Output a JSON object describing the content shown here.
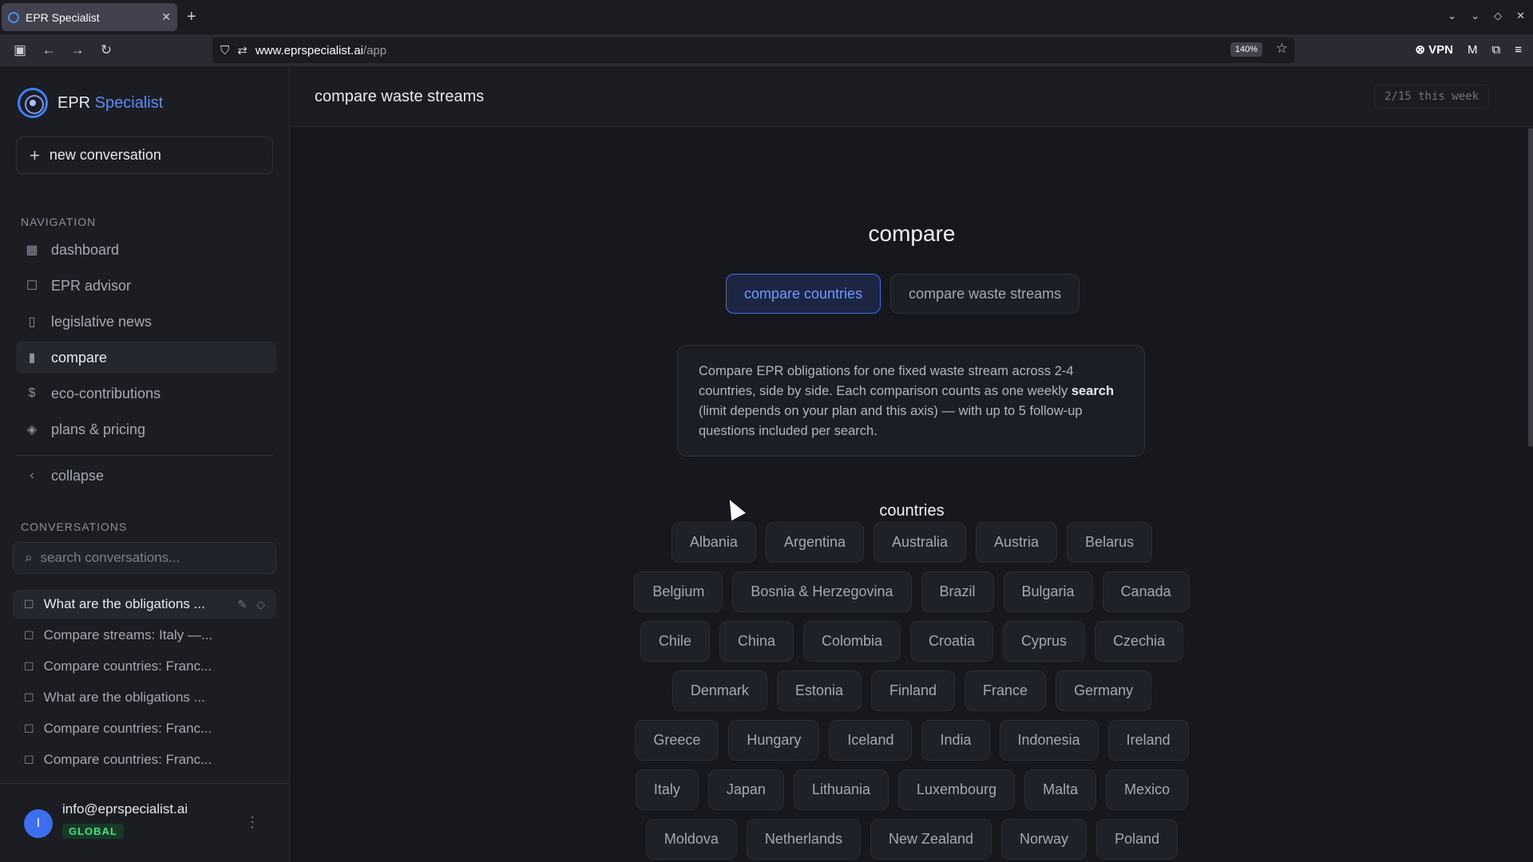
{
  "browser": {
    "tab_title": "EPR Specialist",
    "url_host": "www.eprspecialist.ai",
    "url_path": "/app",
    "zoom": "140%",
    "vpn_label": "VPN",
    "account_initial": "M"
  },
  "sidebar": {
    "brand_part1": "EPR",
    "brand_part2": "Specialist",
    "new_conversation": "new conversation",
    "navigation_label": "NAVIGATION",
    "nav_items": [
      {
        "label": "dashboard",
        "icon": "grid-icon"
      },
      {
        "label": "EPR advisor",
        "icon": "chat-icon"
      },
      {
        "label": "legislative news",
        "icon": "document-icon"
      },
      {
        "label": "compare",
        "icon": "bar-chart-icon"
      },
      {
        "label": "eco-contributions",
        "icon": "dollar-icon"
      },
      {
        "label": "plans & pricing",
        "icon": "layers-icon"
      }
    ],
    "collapse": "collapse",
    "conversations_label": "CONVERSATIONS",
    "search_placeholder": "search conversations...",
    "conversations": [
      "What are the obligations ...",
      "Compare streams: Italy —...",
      "Compare countries: Franc...",
      "What are the obligations ...",
      "Compare countries: Franc...",
      "Compare countries: Franc..."
    ],
    "user_email": "info@eprspecialist.ai",
    "user_initial": "I",
    "plan": "GLOBAL"
  },
  "header": {
    "title": "compare waste streams",
    "usage": "2/15 this week"
  },
  "main": {
    "title": "compare",
    "tabs": [
      "compare countries",
      "compare waste streams"
    ],
    "info_part1": "Compare EPR obligations for one fixed waste stream across 2-4 countries, side by side. Each comparison counts as one weekly ",
    "info_bold": "search",
    "info_part2": " (limit depends on your plan and this axis) — with up to 5 follow-up questions included per search.",
    "countries_label": "countries",
    "country_rows": [
      [
        "Albania",
        "Argentina",
        "Australia",
        "Austria",
        "Belarus"
      ],
      [
        "Belgium",
        "Bosnia & Herzegovina",
        "Brazil",
        "Bulgaria",
        "Canada"
      ],
      [
        "Chile",
        "China",
        "Colombia",
        "Croatia",
        "Cyprus",
        "Czechia"
      ],
      [
        "Denmark",
        "Estonia",
        "Finland",
        "France",
        "Germany"
      ],
      [
        "Greece",
        "Hungary",
        "Iceland",
        "India",
        "Indonesia",
        "Ireland"
      ],
      [
        "Italy",
        "Japan",
        "Lithuania",
        "Luxembourg",
        "Malta",
        "Mexico"
      ],
      [
        "Moldova",
        "Netherlands",
        "New Zealand",
        "Norway",
        "Poland"
      ]
    ]
  },
  "colors": {
    "accent": "#3b6ff0",
    "brand_blue": "#5b8ef7",
    "plan_green": "#4ade80"
  }
}
